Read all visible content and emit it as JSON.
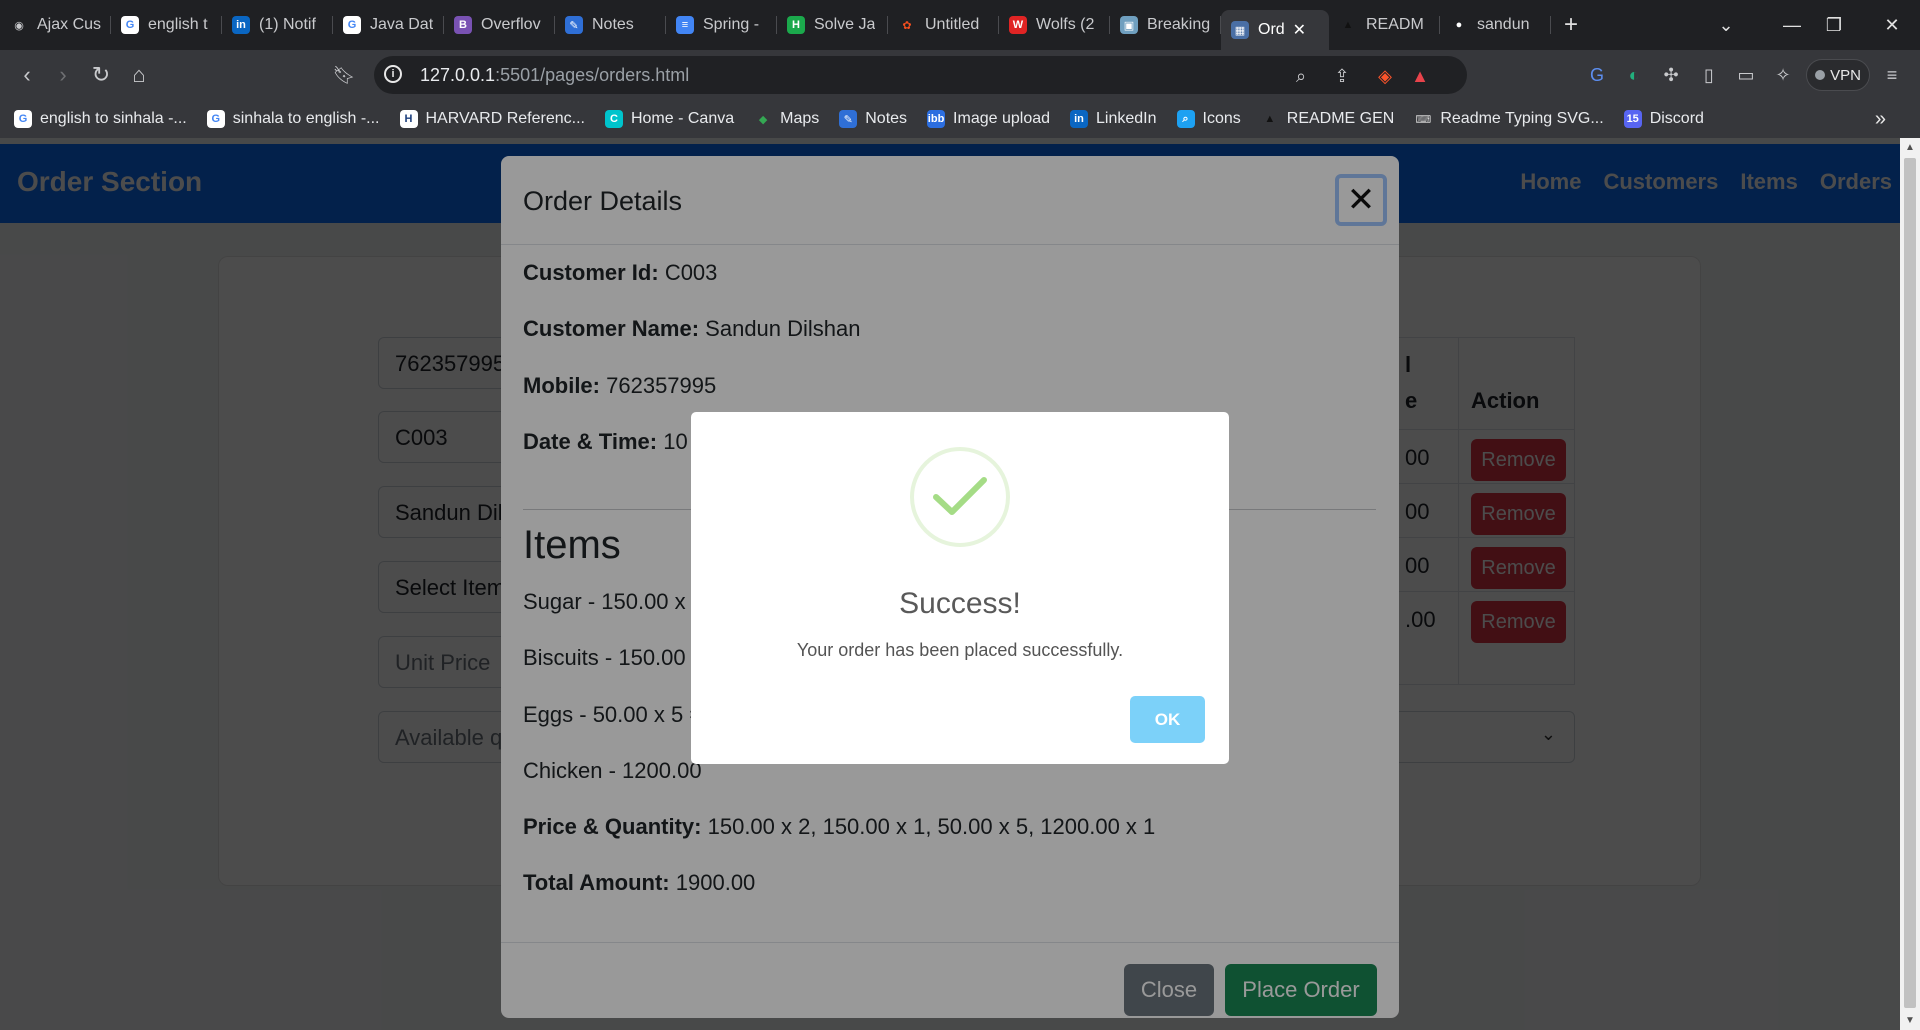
{
  "browser": {
    "tabs": [
      {
        "label": "Ajax Cus",
        "icon": "brave-icon"
      },
      {
        "label": "english t",
        "icon": "google-icon"
      },
      {
        "label": "(1) Notif",
        "icon": "linkedin-icon"
      },
      {
        "label": "Java Dat",
        "icon": "google-icon"
      },
      {
        "label": "Overflov",
        "icon": "bootstrap-icon"
      },
      {
        "label": "Notes",
        "icon": "notes-icon"
      },
      {
        "label": "Spring -",
        "icon": "docs-icon"
      },
      {
        "label": "Solve Ja",
        "icon": "hackerrank-icon"
      },
      {
        "label": "Untitled",
        "icon": "figma-icon"
      },
      {
        "label": "Wolfs (2",
        "icon": "wolf-icon"
      },
      {
        "label": "Breaking",
        "icon": "image-icon"
      }
    ],
    "active_tab": {
      "label": "Ord",
      "icon": "calendar-icon"
    },
    "tabs_after": [
      {
        "label": "READM",
        "icon": "readme-icon"
      },
      {
        "label": "sandun",
        "icon": "github-icon"
      }
    ],
    "url_prefix": "127.0.0.1",
    "url_rest": ":5501/pages/orders.html",
    "vpn_label": "VPN",
    "bookmarks": [
      {
        "label": "english to sinhala -...",
        "icon": "google-icon"
      },
      {
        "label": "sinhala to english -...",
        "icon": "google-icon"
      },
      {
        "label": "HARVARD Referenc...",
        "icon": "harvard-icon"
      },
      {
        "label": "Home - Canva",
        "icon": "canva-icon"
      },
      {
        "label": "Maps",
        "icon": "maps-icon"
      },
      {
        "label": "Notes",
        "icon": "notes-icon"
      },
      {
        "label": "Image upload",
        "icon": "ibb-icon"
      },
      {
        "label": "LinkedIn",
        "icon": "linkedin-icon"
      },
      {
        "label": "Icons",
        "icon": "search-icon"
      },
      {
        "label": "README GEN",
        "icon": "readme-icon"
      },
      {
        "label": "Readme Typing SVG...",
        "icon": "keyboard-icon"
      },
      {
        "label": "Discord",
        "icon": "discord-icon"
      }
    ]
  },
  "site": {
    "brand": "Order Section",
    "links": [
      "Home",
      "Customers",
      "Items",
      "Orders"
    ]
  },
  "form": {
    "mobile_value": "762357995",
    "customer_id_value": "C003",
    "customer_name_value": "Sandun Dil",
    "item_select": "Select Item",
    "unit_price_placeholder": "Unit Price",
    "available_placeholder": "Available q"
  },
  "table": {
    "header_frag_1": "l",
    "header_frag_2": "e",
    "action_header": "Action",
    "rows": [
      {
        "price_frag": "00",
        "action": "Remove"
      },
      {
        "price_frag": "00",
        "action": "Remove"
      },
      {
        "price_frag": "00",
        "action": "Remove"
      },
      {
        "price_frag": ".00",
        "action": "Remove"
      }
    ]
  },
  "order_modal": {
    "title": "Order Details",
    "customer_id_label": "Customer Id:",
    "customer_id": "C003",
    "customer_name_label": "Customer Name:",
    "customer_name": "Sandun Dilshan",
    "mobile_label": "Mobile:",
    "mobile": "762357995",
    "datetime_label": "Date & Time:",
    "datetime": "10",
    "items_heading": "Items",
    "items": [
      "Sugar - 150.00 x",
      "Biscuits - 150.00",
      "Eggs - 50.00 x 5 =",
      "Chicken - 1200.00"
    ],
    "price_qty_label": "Price & Quantity:",
    "price_qty": "150.00 x 2, 150.00 x 1, 50.00 x 5, 1200.00 x 1",
    "total_label": "Total Amount:",
    "total": "1900.00",
    "close_label": "Close",
    "place_order_label": "Place Order"
  },
  "alert": {
    "icon": "success-check-icon",
    "title": "Success!",
    "text": "Your order has been placed successfully.",
    "ok_label": "OK"
  },
  "colors": {
    "primary": "#0d6efd",
    "danger": "#dc3545",
    "success": "#198754",
    "secondary": "#6c757d",
    "alert_ok": "#7cd1f9",
    "check": "#a5dc86"
  }
}
